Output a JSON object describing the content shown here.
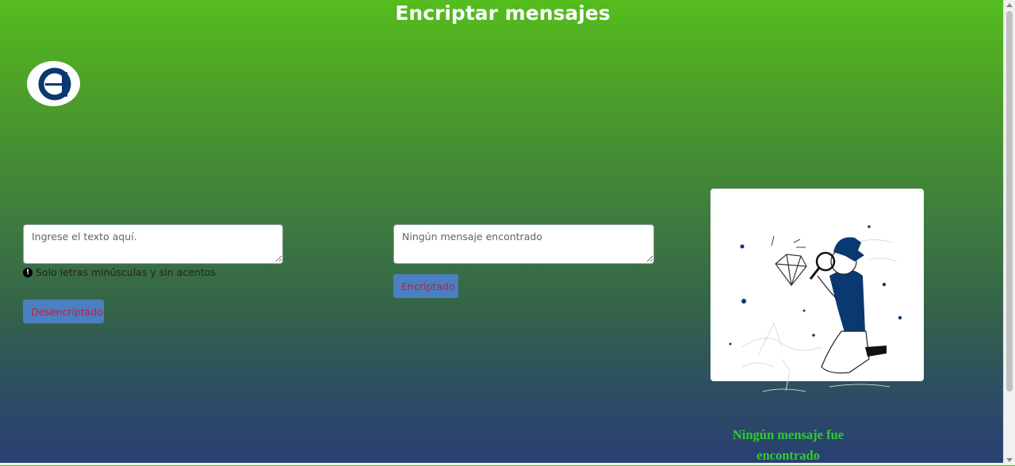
{
  "header": {
    "title": "Encriptar mensajes"
  },
  "logo": {
    "icon": "alura-logo-icon",
    "letter": "a",
    "color": "#0a3871"
  },
  "input": {
    "placeholder": "Ingrese el texto aquí.",
    "value": "",
    "hint_icon": "exclamation-circle-icon",
    "hint": "Solo letras minúsculas y sin acentos"
  },
  "output": {
    "placeholder": "Ningún mensaje encontrado",
    "value": ""
  },
  "buttons": {
    "decrypt_label": "Desencriptado",
    "encrypt_label": "Encriptado"
  },
  "result": {
    "illustration": "person-with-magnifying-glass-and-diamond-illustration",
    "message": "Ningún mensaje fue encontrado"
  },
  "theme": {
    "gradient_top": "#55bd1d",
    "gradient_bottom": "#2a3f74",
    "button_bg": "#4a7fc1",
    "button_text": "#c0203a",
    "message_color": "#2ecc2e",
    "illustration_accent": "#0a3871"
  }
}
